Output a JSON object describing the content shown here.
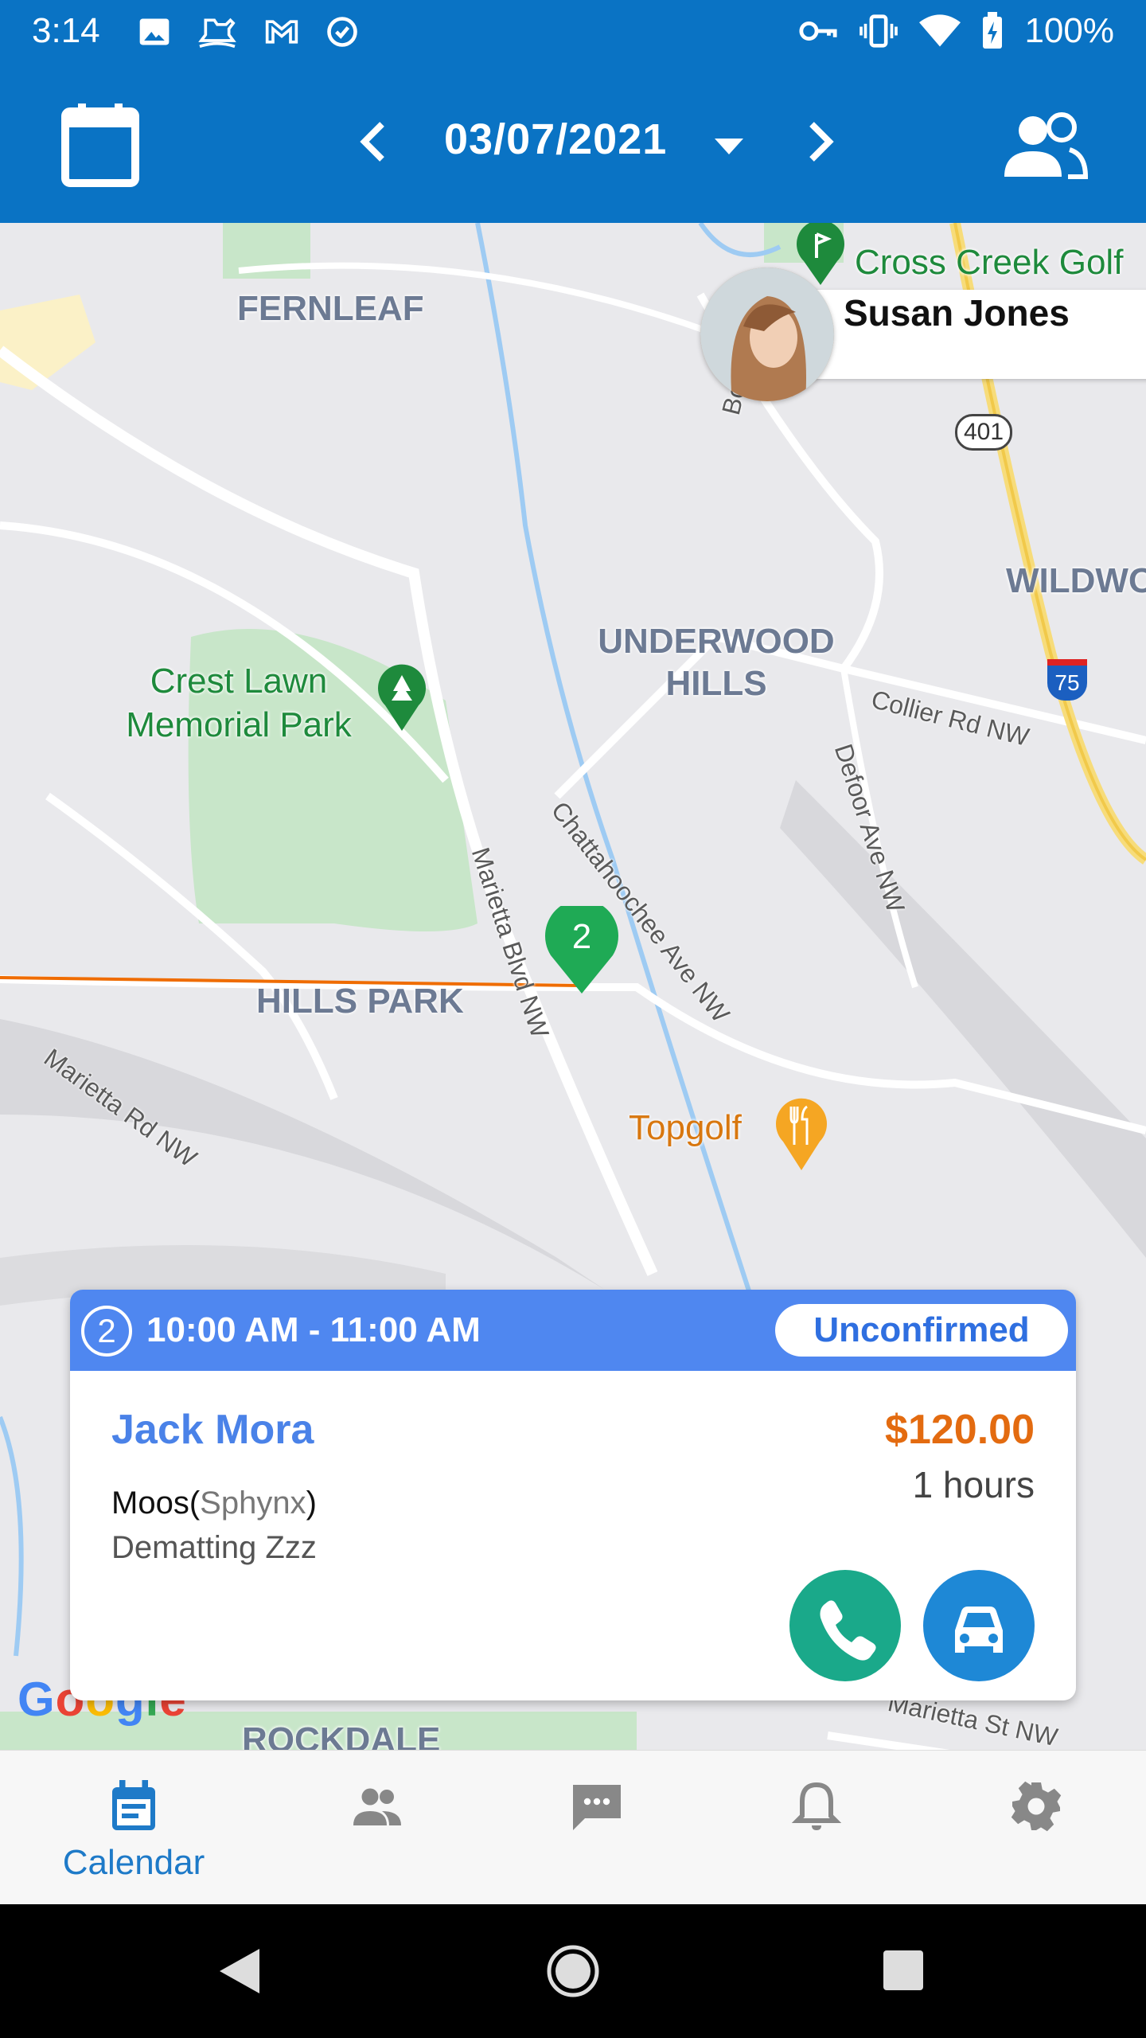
{
  "status_bar": {
    "time": "3:14",
    "battery": "100%",
    "icons": [
      "image-icon",
      "rocking-horse-icon",
      "gmail-icon",
      "sync-icon",
      "vpn-key-icon",
      "vibrate-icon",
      "wifi-icon",
      "battery-charging-icon"
    ]
  },
  "app_bar": {
    "date": "03/07/2021",
    "icons": [
      "calendar-icon",
      "chevron-left-icon",
      "dropdown-arrow-icon",
      "chevron-right-icon",
      "people-icon"
    ]
  },
  "map": {
    "neighborhoods": [
      "FERNLEAF",
      "UNDERWOOD HILLS",
      "HILLS PARK",
      "WILDWO",
      "ROCKDALE"
    ],
    "places": {
      "park": "Crest Lawn Memorial Park",
      "golf": "Cross Creek Golf",
      "restaurant": "Topgolf"
    },
    "roads": [
      "Marietta Rd NW",
      "Marietta Blvd NW",
      "Chattahoochee Ave NW",
      "Defoor Ave NW",
      "Collier Rd NW",
      "Marietta St NW",
      "Bol"
    ],
    "highway_401": "401",
    "highway_75": "75",
    "marker_number": "2",
    "google_logo": "Google",
    "staff": {
      "name": "Susan Jones"
    }
  },
  "appointment": {
    "number": "2",
    "time_range": "10:00 AM - 11:00 AM",
    "status": "Unconfirmed",
    "client_name": "Jack Mora",
    "price": "$120.00",
    "duration": "1 hours",
    "pet_name": "Moos",
    "pet_breed": "Sphynx",
    "service": "Dematting Zzz",
    "colors": {
      "header": "#4f87f0",
      "price": "#e36b10",
      "call": "#1aa98a",
      "drive": "#1e88d6"
    }
  },
  "bottom_nav": {
    "items": [
      {
        "label": "Calendar",
        "icon": "calendar-icon",
        "active": true
      },
      {
        "label": "",
        "icon": "clients-icon"
      },
      {
        "label": "",
        "icon": "messages-icon"
      },
      {
        "label": "",
        "icon": "notifications-icon"
      },
      {
        "label": "",
        "icon": "settings-icon"
      }
    ],
    "active_color": "#1e7ac8"
  },
  "colors": {
    "app_bar": "#0a73c4"
  }
}
